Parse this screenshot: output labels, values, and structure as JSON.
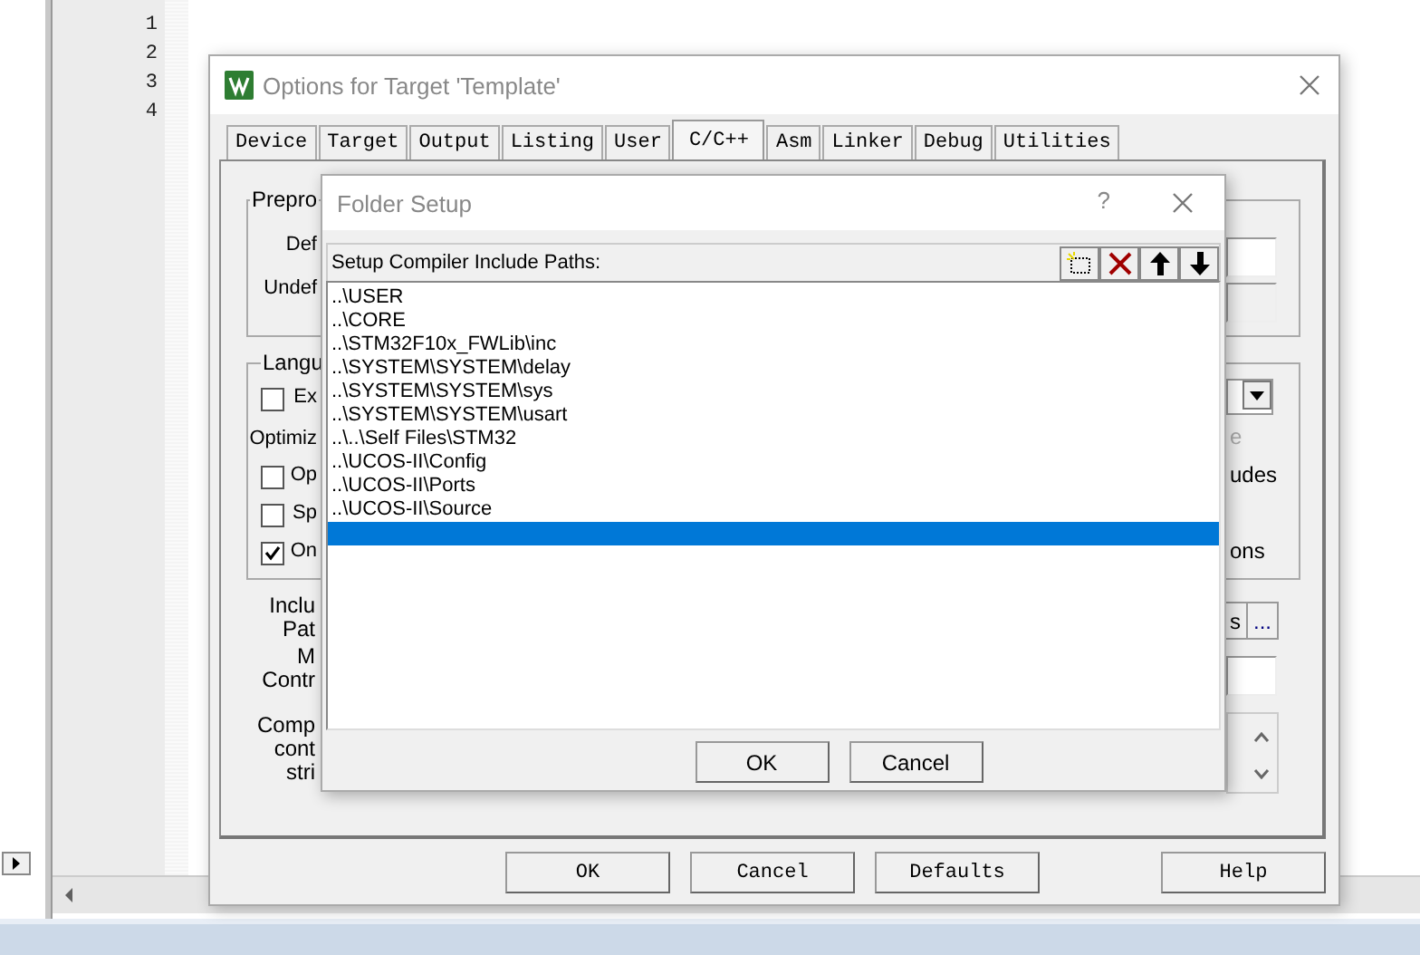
{
  "editor": {
    "line_numbers": [
      "1",
      "2",
      "3",
      "4"
    ]
  },
  "options_dialog": {
    "title": "Options for Target 'Template'",
    "tabs": [
      {
        "label": "Device",
        "selected": false
      },
      {
        "label": "Target",
        "selected": false
      },
      {
        "label": "Output",
        "selected": false
      },
      {
        "label": "Listing",
        "selected": false
      },
      {
        "label": "User",
        "selected": false
      },
      {
        "label": "C/C++",
        "selected": true
      },
      {
        "label": "Asm",
        "selected": false
      },
      {
        "label": "Linker",
        "selected": false
      },
      {
        "label": "Debug",
        "selected": false
      },
      {
        "label": "Utilities",
        "selected": false
      }
    ],
    "panel": {
      "preprocessor_title": "Prepro",
      "define_label": "Def",
      "undefine_label": "Undef",
      "language_title": "Langu",
      "optimize_label": "Optimiz",
      "checkboxes": [
        {
          "label": "Ex",
          "checked": false
        },
        {
          "label": "Op",
          "checked": false
        },
        {
          "label": "Sp",
          "checked": false
        },
        {
          "label": "On",
          "checked": true
        }
      ],
      "right_texts": [
        {
          "text": "e",
          "disabled": true
        },
        {
          "text": "udes",
          "disabled": false
        },
        {
          "text": "ons",
          "disabled": false
        }
      ],
      "include_label": [
        "Inclu",
        "Pat"
      ],
      "misc_label": [
        "M",
        "Contr"
      ],
      "compiler_label": [
        "Comp",
        "cont",
        "stri"
      ],
      "browse_buttons": [
        "s",
        "..."
      ]
    },
    "buttons": [
      "OK",
      "Cancel",
      "Defaults",
      "Help"
    ]
  },
  "folder_dialog": {
    "title": "Folder Setup",
    "help": "?",
    "header": "Setup Compiler Include Paths:",
    "paths": [
      {
        "path": "..\\USER",
        "selected": false
      },
      {
        "path": "..\\CORE",
        "selected": false
      },
      {
        "path": "..\\STM32F10x_FWLib\\inc",
        "selected": false
      },
      {
        "path": "..\\SYSTEM\\SYSTEM\\delay",
        "selected": false
      },
      {
        "path": "..\\SYSTEM\\SYSTEM\\sys",
        "selected": false
      },
      {
        "path": "..\\SYSTEM\\SYSTEM\\usart",
        "selected": false
      },
      {
        "path": "..\\..\\Self Files\\STM32",
        "selected": false
      },
      {
        "path": "..\\UCOS-II\\Config",
        "selected": false
      },
      {
        "path": "..\\UCOS-II\\Ports",
        "selected": false
      },
      {
        "path": "..\\UCOS-II\\Source",
        "selected": false
      },
      {
        "selected": true
      }
    ],
    "buttons": [
      "OK",
      "Cancel"
    ]
  }
}
